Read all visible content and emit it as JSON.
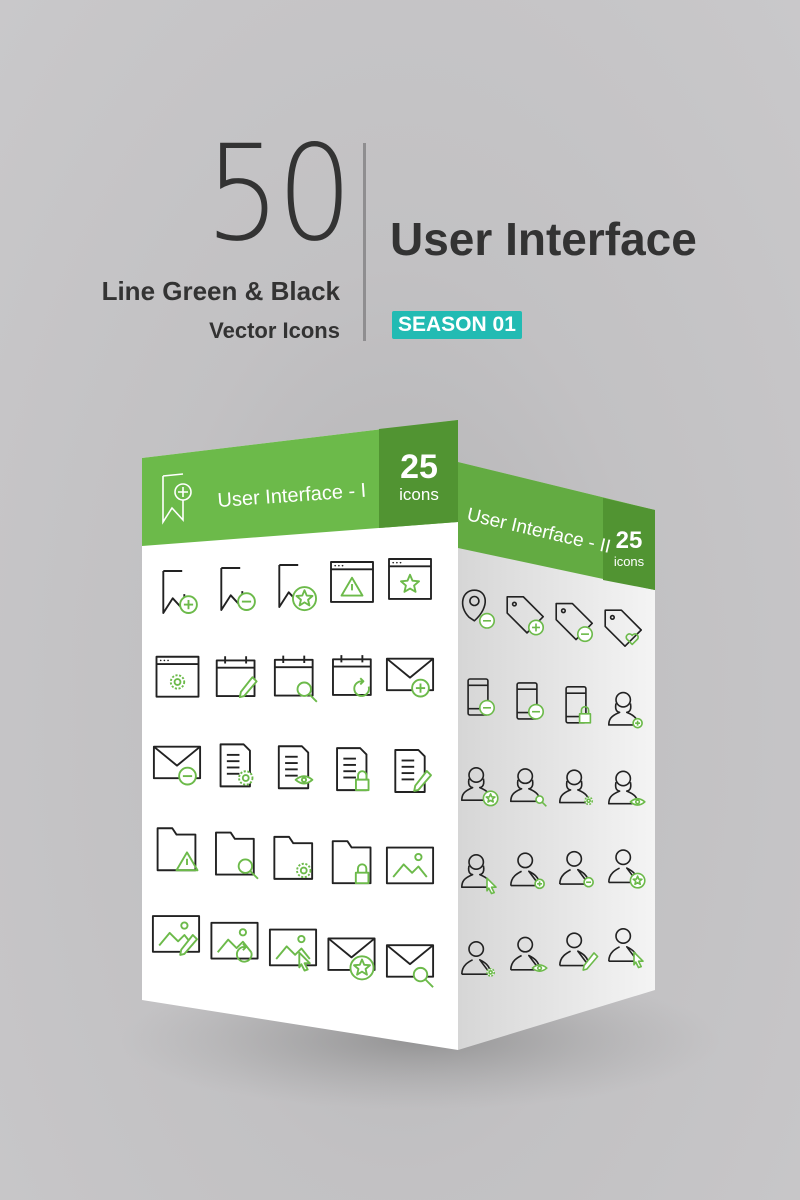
{
  "header": {
    "count": "50",
    "line1": "Line Green & Black",
    "line2": "Vector Icons",
    "title": "User Interface",
    "badge": "SEASON 01"
  },
  "colors": {
    "green": "#6cba4a",
    "dark_green": "#519432",
    "badge": "#22bbb3",
    "text": "#333333"
  },
  "panels": [
    {
      "title": "User Interface - I",
      "count": "25",
      "count_label": "icons",
      "header_icon": "bookmark-add",
      "icons": [
        "bookmark-add",
        "bookmark-remove",
        "bookmark-star",
        "browser-warning",
        "browser-star",
        "browser-settings",
        "calendar-edit",
        "calendar-search",
        "calendar-refresh",
        "mail-add",
        "mail-remove",
        "document-settings",
        "document-view",
        "document-lock",
        "document-edit",
        "folder-warning",
        "folder-search",
        "folder-settings",
        "folder-lock",
        "image",
        "image-edit",
        "image-refresh",
        "image-cursor",
        "mail-star",
        "mail-search"
      ]
    },
    {
      "title": "User Interface - II",
      "count": "25",
      "count_label": "icons",
      "icons": [
        "location-remove",
        "tag-add",
        "tag-remove",
        "tag-heart",
        "phone-check",
        "phone-remove",
        "phone-lock",
        "user-female-add",
        "user-female-star",
        "user-female-search",
        "user-female-settings",
        "user-female-view",
        "user-female-cursor",
        "user-add",
        "user-remove",
        "user-star",
        "user-settings",
        "user-view",
        "user-edit",
        "user-cursor"
      ]
    }
  ]
}
